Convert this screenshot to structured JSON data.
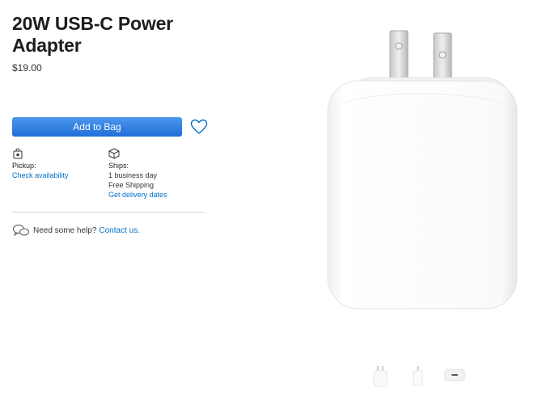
{
  "product": {
    "title": "20W USB-C Power Adapter",
    "price": "$19.00"
  },
  "actions": {
    "add_to_bag": "Add to Bag",
    "favorite_icon": "heart-icon"
  },
  "pickup": {
    "icon": "store-bag-icon",
    "label": "Pickup:",
    "link": "Check availability"
  },
  "ships": {
    "icon": "box-icon",
    "label": "Ships:",
    "line1": "1 business day",
    "line2": "Free Shipping",
    "link": "Get delivery dates"
  },
  "help": {
    "icon": "chat-bubbles-icon",
    "text": "Need some help?",
    "link": "Contact us."
  },
  "gallery": {
    "thumbnails": [
      "front-view",
      "side-view",
      "plug-view"
    ],
    "selected_index": 0
  },
  "colors": {
    "link": "#0070c9",
    "button": "#1f6fd8",
    "text": "#1d1d1f"
  }
}
